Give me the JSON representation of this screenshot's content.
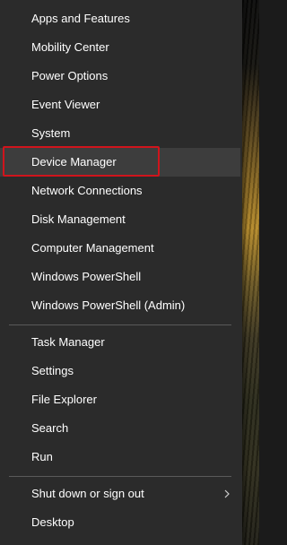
{
  "menu": {
    "items": [
      {
        "label": "Apps and Features"
      },
      {
        "label": "Mobility Center"
      },
      {
        "label": "Power Options"
      },
      {
        "label": "Event Viewer"
      },
      {
        "label": "System"
      },
      {
        "label": "Device Manager"
      },
      {
        "label": "Network Connections"
      },
      {
        "label": "Disk Management"
      },
      {
        "label": "Computer Management"
      },
      {
        "label": "Windows PowerShell"
      },
      {
        "label": "Windows PowerShell (Admin)"
      },
      {
        "label": "Task Manager"
      },
      {
        "label": "Settings"
      },
      {
        "label": "File Explorer"
      },
      {
        "label": "Search"
      },
      {
        "label": "Run"
      },
      {
        "label": "Shut down or sign out"
      },
      {
        "label": "Desktop"
      }
    ],
    "highlighted_item": "Device Manager",
    "highlight_color": "#d0141c",
    "submenu_icon": "chevron-right-icon"
  }
}
